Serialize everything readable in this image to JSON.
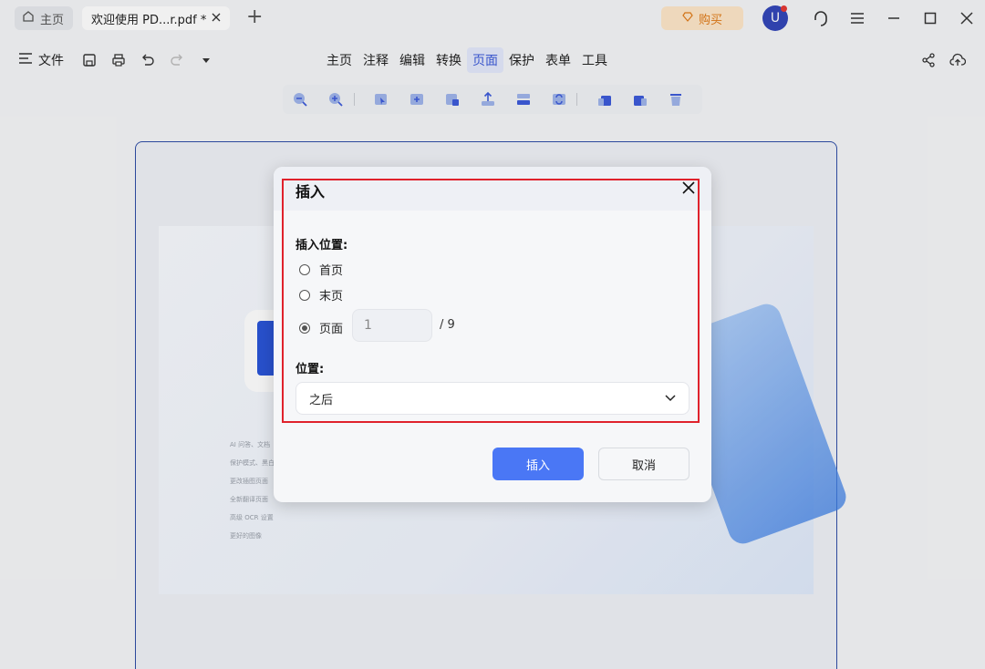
{
  "tabs": {
    "home_label": "主页",
    "doc_label": "欢迎使用 PD...r.pdf *"
  },
  "header": {
    "buy_label": "购买",
    "avatar_letter": "U"
  },
  "menubar": {
    "file_label": "文件",
    "items": [
      "主页",
      "注释",
      "编辑",
      "转换",
      "页面",
      "保护",
      "表单",
      "工具"
    ],
    "active_item": "页面"
  },
  "background_doc": {
    "features": [
      "AI 问答、文档",
      "保护模式、黑白",
      "更改插图页面",
      "全新翻译页面",
      "高级 OCR 设置",
      "更好的图像"
    ]
  },
  "dialog": {
    "title": "插入",
    "position_label": "插入位置:",
    "options": [
      "首页",
      "末页",
      "页面"
    ],
    "selected_option": "页面",
    "page_value": "1",
    "page_total": "/ 9",
    "placement_label": "位置:",
    "placement_value": "之后",
    "insert_button": "插入",
    "cancel_button": "取消"
  },
  "colors": {
    "accent": "#4a77f5",
    "highlight_border": "#e0222c",
    "buy_bg": "#fde6c8",
    "avatar_bg": "#3447b8"
  }
}
